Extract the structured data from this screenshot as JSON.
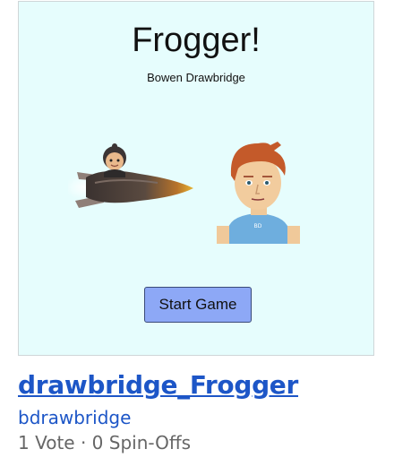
{
  "thumbnail": {
    "game_title": "Frogger!",
    "game_author": "Bowen Drawbridge",
    "start_button": "Start Game",
    "shirt_label": "BD",
    "colors": {
      "background": "#e6fdfd",
      "button": "#8da8f6"
    },
    "sprites": [
      "rocket-ship-with-pilot",
      "boy-avatar"
    ]
  },
  "project": {
    "title": "drawbridge_Frogger",
    "author": "bdrawbridge",
    "stats": "1 Vote · 0 Spin-Offs",
    "link_color": "#1d56c7"
  }
}
